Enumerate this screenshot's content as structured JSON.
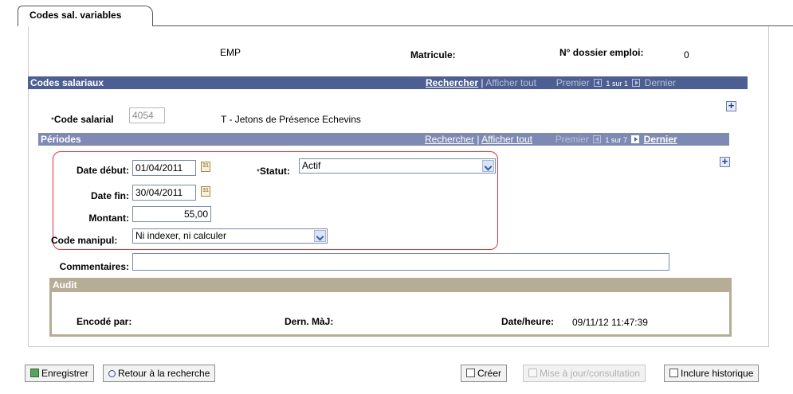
{
  "tab": {
    "label": "Codes sal. variables"
  },
  "header": {
    "emp_value": "EMP",
    "matricule_label": "Matricule:",
    "dossier_label": "N° dossier emploi:",
    "dossier_value": "0"
  },
  "grid_codes": {
    "title": "Codes salariaux",
    "find": "Rechercher",
    "view_all": "Afficher tout",
    "first": "Premier",
    "count_pre": "1",
    "count_word": "sur",
    "count_post": "1",
    "last": "Dernier",
    "code_label": "Code salarial",
    "code_value": "4054",
    "code_desc": "T - Jetons de Présence Echevins"
  },
  "grid_periods": {
    "title": "Périodes",
    "find": "Rechercher",
    "view_all": "Afficher tout",
    "first": "Premier",
    "count_pre": "1",
    "count_word": "sur",
    "count_post": "7",
    "last": "Dernier"
  },
  "form": {
    "date_debut_label": "Date début:",
    "date_debut_value": "01/04/2011",
    "statut_label": "Statut:",
    "statut_value": "Actif",
    "date_fin_label": "Date fin:",
    "date_fin_value": "30/04/2011",
    "montant_label": "Montant:",
    "montant_value": "55,00",
    "code_manipul_label": "Code manipul:",
    "code_manipul_value": "Ni indexer, ni calculer",
    "commentaires_label": "Commentaires:",
    "commentaires_value": "",
    "required_marker": "*",
    "calendar_icon_text": "31"
  },
  "audit": {
    "title": "Audit",
    "encode_par_label": "Encodé par:",
    "dern_maj_label": "Dern. MàJ:",
    "date_heure_label": "Date/heure:",
    "date_heure_value": "09/11/12 11:47:39"
  },
  "toolbar": {
    "save": "Enregistrer",
    "return_search": "Retour à la recherche",
    "create": "Créer",
    "update_view": "Mise à jour/consultation",
    "include_history": "Inclure historique"
  },
  "icons": {
    "save": "save-icon",
    "search": "search-icon",
    "create": "add-row-icon",
    "update": "update-icon",
    "history": "history-icon",
    "calendar": "calendar-icon",
    "plus": "plus-icon"
  },
  "colors": {
    "grid_header": "#4d5e93",
    "subgrid_header": "#7e8ab3",
    "audit_header": "#b6ad97",
    "highlight": "#e0323a"
  }
}
